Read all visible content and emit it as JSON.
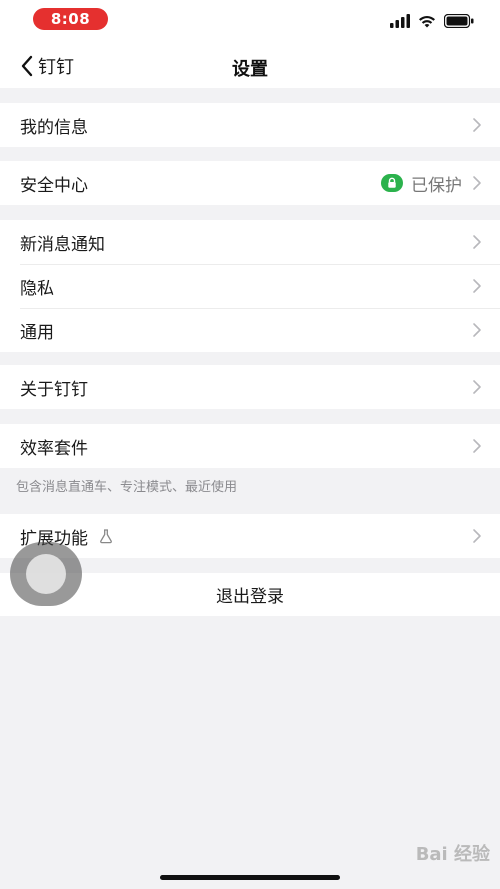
{
  "status_bar": {
    "time": "8:08"
  },
  "nav": {
    "back_label": "钉钉",
    "title": "设置"
  },
  "groups": {
    "info": {
      "label": "我的信息"
    },
    "security": {
      "label": "安全中心",
      "value": "已保护"
    },
    "notifications": {
      "label": "新消息通知"
    },
    "privacy": {
      "label": "隐私"
    },
    "general": {
      "label": "通用"
    },
    "about": {
      "label": "关于钉钉"
    },
    "efficiency": {
      "label": "效率套件",
      "hint": "包含消息直通车、专注模式、最近使用"
    },
    "extensions": {
      "label": "扩展功能"
    }
  },
  "logout": {
    "label": "退出登录"
  },
  "watermark": {
    "text": "Bai 经验"
  },
  "colors": {
    "time_pill": "#e5302f",
    "protected_badge": "#2bb24c",
    "background": "#f2f2f4"
  },
  "icons": [
    "back-chevron-icon",
    "signal-icon",
    "wifi-icon",
    "battery-icon",
    "lock-icon",
    "chevron-right-icon",
    "flask-icon"
  ]
}
